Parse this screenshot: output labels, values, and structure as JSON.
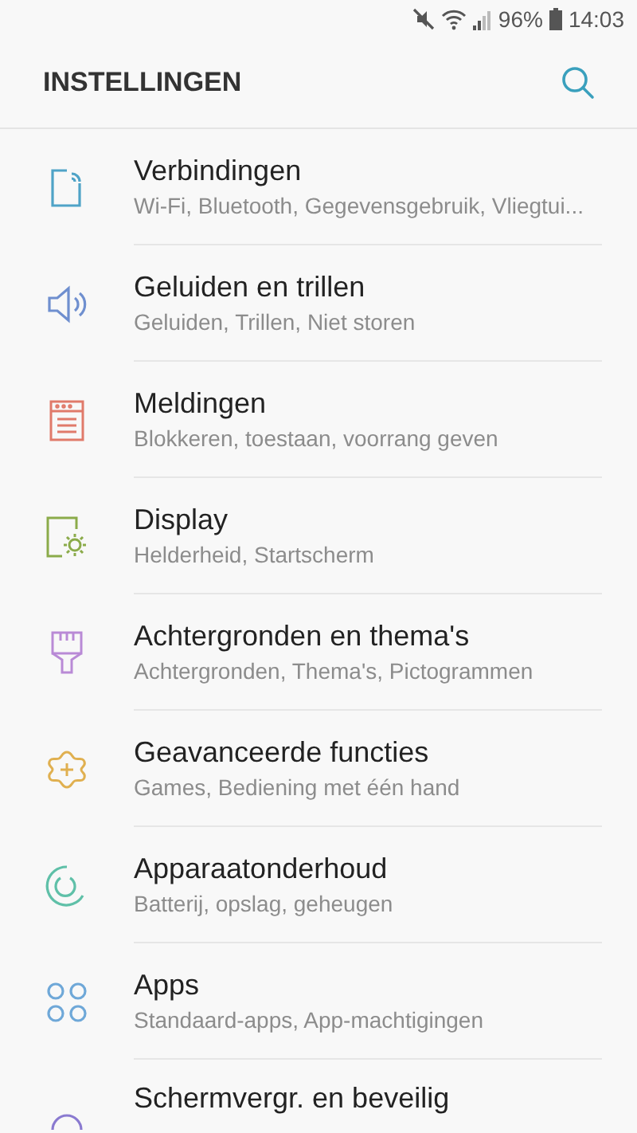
{
  "status_bar": {
    "battery": "96%",
    "time": "14:03"
  },
  "header": {
    "title": "INSTELLINGEN"
  },
  "items": [
    {
      "kind": "connections",
      "color": "#4fa3c7",
      "title": "Verbindingen",
      "subtitle": "Wi-Fi, Bluetooth, Gegevensgebruik, Vliegtui..."
    },
    {
      "kind": "sound",
      "color": "#6f8fcf",
      "title": "Geluiden en trillen",
      "subtitle": "Geluiden, Trillen, Niet storen"
    },
    {
      "kind": "notifications",
      "color": "#e07a6a",
      "title": "Meldingen",
      "subtitle": "Blokkeren, toestaan, voorrang geven"
    },
    {
      "kind": "display",
      "color": "#8bab4a",
      "title": "Display",
      "subtitle": "Helderheid, Startscherm"
    },
    {
      "kind": "brush",
      "color": "#b98ad6",
      "title": "Achtergronden en thema's",
      "subtitle": "Achtergronden, Thema's, Pictogrammen"
    },
    {
      "kind": "advanced",
      "color": "#e0b050",
      "title": "Geavanceerde functies",
      "subtitle": "Games, Bediening met één hand"
    },
    {
      "kind": "maintenance",
      "color": "#5fc0a8",
      "title": "Apparaatonderhoud",
      "subtitle": "Batterij, opslag, geheugen"
    },
    {
      "kind": "apps",
      "color": "#6fa8d8",
      "title": "Apps",
      "subtitle": "Standaard-apps, App-machtigingen"
    },
    {
      "kind": "lock",
      "color": "#8a7ad0",
      "title": "Schermvergr. en beveilig"
    }
  ]
}
